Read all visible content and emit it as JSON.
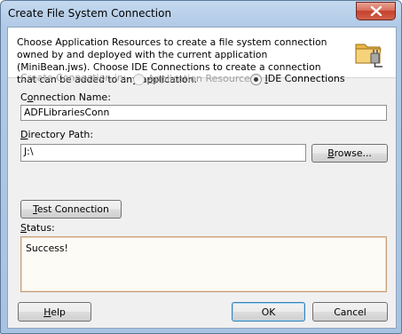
{
  "window": {
    "title": "Create File System Connection",
    "close_label": "Close"
  },
  "header": {
    "description": "Choose Application Resources to create a file system connection owned by and deployed with the current application (MiniBean.jws). Choose IDE Connections to create a connection that can be added to any application.",
    "icon": "folder-plug-icon"
  },
  "create_in": {
    "label": "Create Connection in:",
    "option_app_prefix": "",
    "option_app_mnemonic": "A",
    "option_app_rest": "pplication Resources",
    "option_ide_mnemonic": "I",
    "option_ide_rest": "DE Connections",
    "selected": "IDE Connections"
  },
  "connection_name": {
    "label_prefix": "C",
    "label_mnemonic": "o",
    "label_rest": "nnection Name:",
    "value": "ADFLibrariesConn"
  },
  "directory_path": {
    "label_mnemonic": "D",
    "label_rest": "irectory Path:",
    "value": "J:\\",
    "browse_mnemonic": "B",
    "browse_rest": "rowse..."
  },
  "test_connection": {
    "mnemonic": "T",
    "rest": "est Connection"
  },
  "status": {
    "label_mnemonic": "S",
    "label_rest": "tatus:",
    "value": "Success!"
  },
  "buttons": {
    "help_mnemonic": "H",
    "help_rest": "elp",
    "ok": "OK",
    "cancel": "Cancel"
  }
}
